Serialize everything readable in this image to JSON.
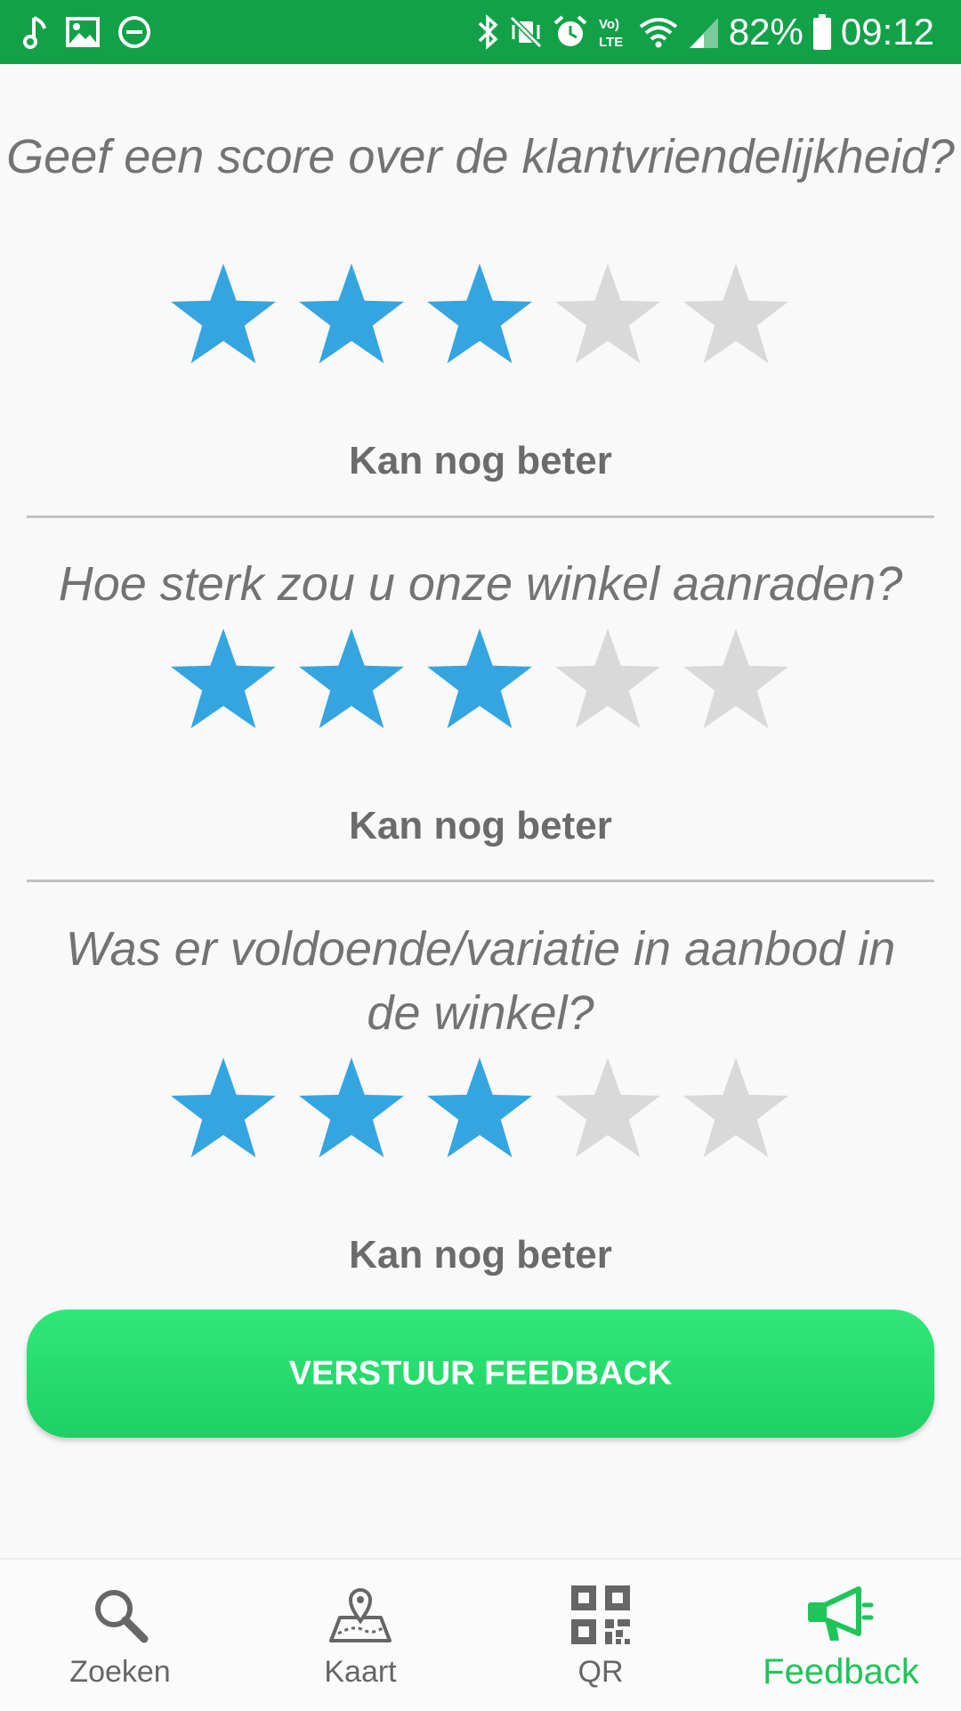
{
  "status_bar": {
    "battery_percent": "82%",
    "time": "09:12",
    "left_icons": [
      "music-note-icon",
      "image-icon",
      "do-not-disturb-icon"
    ],
    "right_icons": [
      "bluetooth-icon",
      "vibrate-mute-icon",
      "alarm-icon",
      "volte-icon",
      "wifi-icon",
      "signal-icon",
      "battery-icon"
    ],
    "bg_color": "#12a148"
  },
  "questions": [
    {
      "text": "Geef een score over de klantvriendelijkheid?",
      "rating": 3,
      "max_rating": 5,
      "rating_label": "Kan nog beter"
    },
    {
      "text": "Hoe sterk zou u onze winkel aanraden?",
      "rating": 3,
      "max_rating": 5,
      "rating_label": "Kan nog beter"
    },
    {
      "text": "Was er voldoende/variatie in aanbod in de winkel?",
      "rating": 3,
      "max_rating": 5,
      "rating_label": "Kan nog beter"
    }
  ],
  "colors": {
    "star_filled": "#35a5e0",
    "star_empty": "#d9d9d9",
    "button": "#26dd6c",
    "nav_active": "#1fc45a",
    "nav_inactive": "#666666"
  },
  "submit_label": "VERSTUUR FEEDBACK",
  "nav": {
    "items": [
      {
        "label": "Zoeken",
        "icon": "search-icon",
        "active": false
      },
      {
        "label": "Kaart",
        "icon": "map-icon",
        "active": false
      },
      {
        "label": "QR",
        "icon": "qr-code-icon",
        "active": false
      },
      {
        "label": "Feedback",
        "icon": "megaphone-icon",
        "active": true
      }
    ]
  }
}
